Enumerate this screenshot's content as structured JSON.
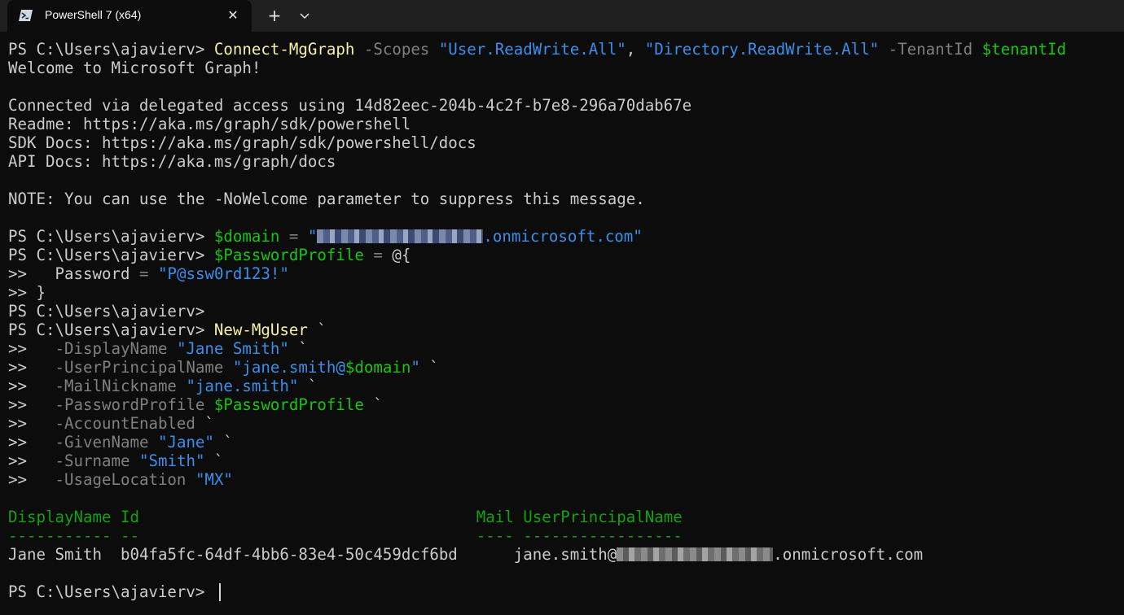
{
  "window": {
    "tab_title": "PowerShell 7 (x64)",
    "close_glyph": "✕",
    "new_tab_glyph": "+",
    "tab_icon": "powershell-icon",
    "dropdown_icon": "chevron-down-icon"
  },
  "console": {
    "prompt": "PS C:\\Users\\ajavierv> ",
    "continuation": ">> ",
    "l1": {
      "cmd": "Connect-MgGraph",
      "p1": " -Scopes",
      "s1": "\"User.ReadWrite.All\"",
      "comma": ",",
      "s2": "\"Directory.ReadWrite.All\"",
      "p2": " -TenantId",
      "var": "$tenantId"
    },
    "out": {
      "welcome": "Welcome to Microsoft Graph!",
      "connected": "Connected via delegated access using 14d82eec-204b-4c2f-b7e8-296a70dab67e",
      "readme": "Readme: https://aka.ms/graph/sdk/powershell",
      "sdk": "SDK Docs: https://aka.ms/graph/sdk/powershell/docs",
      "api": "API Docs: https://aka.ms/graph/docs",
      "note": "NOTE: You can use the -NoWelcome parameter to suppress this message."
    },
    "domain_line": {
      "var": "$domain",
      "op": " = ",
      "q": "\"",
      "suffix": ".onmicrosoft.com\""
    },
    "pp_line": {
      "var": "$PasswordProfile",
      "op": " = ",
      "brace": "@{"
    },
    "pw_line": {
      "key": "  Password",
      "op": " = ",
      "val": "\"P@ssw0rd123!\""
    },
    "close_line": "}",
    "new_user": {
      "cmd": "New-MgUser",
      "tick": "`"
    },
    "params": [
      {
        "name": "  -DisplayName",
        "value": "\"Jane Smith\"",
        "tick": " `"
      },
      {
        "name": "  -UserPrincipalName",
        "value_pre": "\"jane.smith@",
        "value_var": "$domain",
        "value_post": "\"",
        "tick": " `"
      },
      {
        "name": "  -MailNickname",
        "value": "\"jane.smith\"",
        "tick": " `"
      },
      {
        "name": "  -PasswordProfile",
        "var": "$PasswordProfile",
        "tick": " `"
      },
      {
        "name": "  -AccountEnabled",
        "tick": " `"
      },
      {
        "name": "  -GivenName",
        "value": "\"Jane\"",
        "tick": " `"
      },
      {
        "name": "  -Surname",
        "value": "\"Smith\"",
        "tick": " `"
      },
      {
        "name": "  -UsageLocation",
        "value": "\"MX\""
      }
    ],
    "table": {
      "headers": {
        "display_name": "DisplayName",
        "id": "Id",
        "mail": "Mail",
        "upn": "UserPrincipalName"
      },
      "rules": {
        "display_name": "-----------",
        "id": "--",
        "mail": "----",
        "upn": "-----------------"
      },
      "row": {
        "display_name": "Jane Smith",
        "id": "b04fa5fc-64df-4bb6-83e4-50c459dcf6bd",
        "mail": "",
        "upn_prefix": "jane.smith@",
        "upn_suffix": ".onmicrosoft.com"
      }
    }
  },
  "colors": {
    "background": "#0c0c0c",
    "titlebar": "#202020",
    "command": "#f9f1a5",
    "parameter": "#808080",
    "string": "#3b8eea",
    "variable": "#16c60c",
    "table_header": "#13a10e"
  }
}
